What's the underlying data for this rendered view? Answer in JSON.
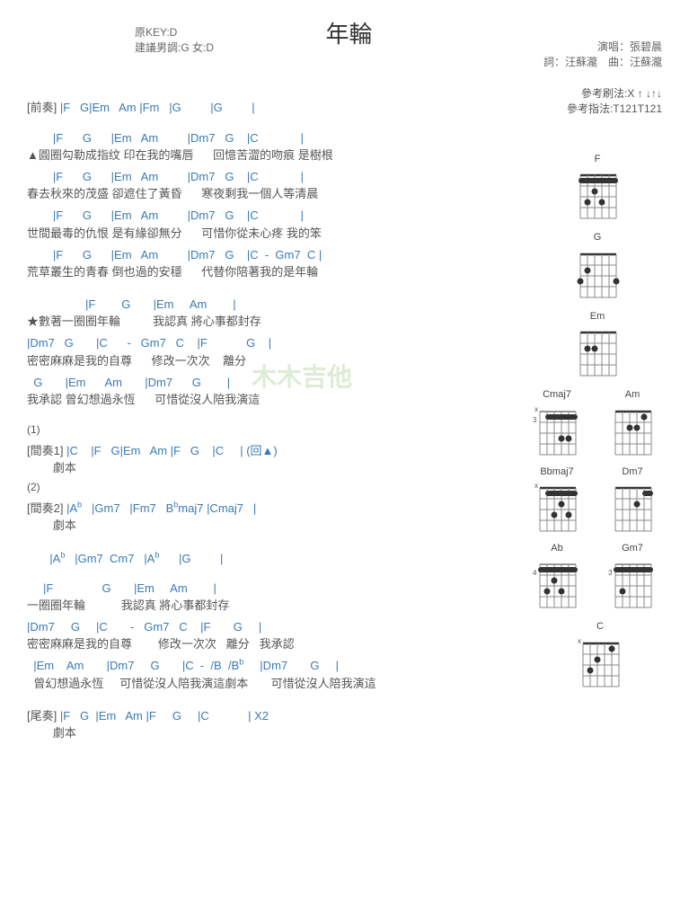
{
  "title": "年輪",
  "meta_left": {
    "key": "原KEY:D",
    "suggest": "建議男調:G 女:D"
  },
  "meta_right": {
    "singer": "演唱：張碧晨",
    "credit": "詞：汪蘇瀧　曲：汪蘇瀧"
  },
  "ref": {
    "strum": "參考刷法:X ↑ ↓↑↓",
    "pick": "參考指法:T121T121"
  },
  "sections": {
    "intro_label": "[前奏]",
    "inter1_label": "[間奏1]",
    "inter2_label": "[間奏2]",
    "outro_label": "[尾奏]"
  },
  "intro_chords": "|F   G|Em   Am |Fm   |G         |G         |",
  "verse": [
    {
      "chords": "        |F      G      |Em   Am         |Dm7   G    |C             |",
      "lyrics": "▲圓圈勾勒成指纹 印在我的嘴唇      回憶苦澀的吻痕 是樹根"
    },
    {
      "chords": "        |F      G      |Em   Am         |Dm7   G    |C             |",
      "lyrics": "春去秋來的茂盛 卻遮住了黃昏      寒夜剩我一個人等清晨"
    },
    {
      "chords": "        |F      G      |Em   Am         |Dm7   G    |C             |",
      "lyrics": "世間最毒的仇恨 是有緣卻無分      可惜你從未心疼 我的笨"
    },
    {
      "chords": "        |F      G      |Em   Am         |Dm7   G    |C  -  Gm7  C |",
      "lyrics": "荒草叢生的青春 倒也過的安穩      代替你陪著我的是年輪"
    }
  ],
  "chorus": [
    {
      "chords": "                  |F        G       |Em     Am        |",
      "lyrics": "★數著一圈圈年輪          我認真 將心事都封存"
    },
    {
      "chords": "|Dm7   G       |C      -   Gm7   C    |F            G    |",
      "lyrics": "密密麻麻是我的自尊      修改一次次    離分"
    },
    {
      "chords": "  G       |Em      Am       |Dm7      G        |",
      "lyrics": "我承認 曾幻想過永恆      可惜從沒人陪我演這"
    }
  ],
  "mark1": "(1)",
  "inter1": {
    "chords": "|C    |F   G|Em   Am |F   G    |C     | (回▲)",
    "lyric": "劇本"
  },
  "mark2": "(2)",
  "inter2_line1": {
    "chords_html": "|A<sup>b</sup>   |Gm7   |Fm7   B<sup>b</sup>maj7 |Cmaj7   |",
    "lyric": "劇本"
  },
  "inter2_line2": {
    "chords_html": "|A<sup>b</sup>   |Gm7  Cm7   |A<sup>b</sup>      |G         |"
  },
  "final": [
    {
      "chords": "     |F               G       |Em     Am        |",
      "lyrics": "一圈圈年輪           我認真 將心事都封存"
    },
    {
      "chords": "|Dm7     G     |C       -   Gm7   C    |F       G     |",
      "lyrics": "密密麻麻是我的自尊        修改一次次   離分   我承認"
    },
    {
      "chords_html": "  |Em    Am       |Dm7     G       |C  -  /B  /B<sup>b</sup>     |Dm7       G     |",
      "lyrics": "  曾幻想過永恆     可惜從沒人陪我演這劇本       可惜從沒人陪我演這"
    }
  ],
  "outro": {
    "chords": "|F   G  |Em   Am |F     G     |C            | X2",
    "lyric": "劇本"
  },
  "diagram_labels": [
    "F",
    "G",
    "Em",
    "Am",
    "Cmaj7",
    "Dm7",
    "Bbmaj7",
    "Gm7",
    "Ab",
    "C"
  ],
  "chart_data": null
}
